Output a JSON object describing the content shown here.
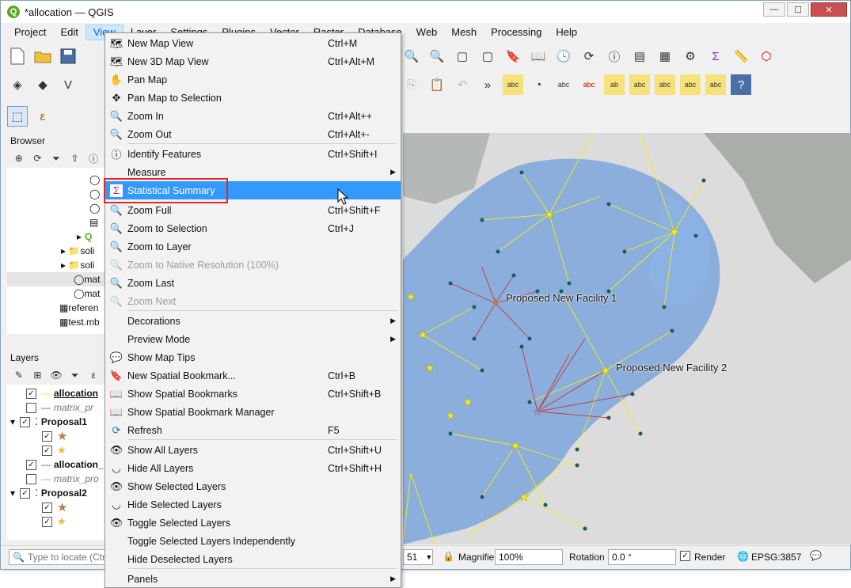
{
  "window": {
    "title": "*allocation — QGIS",
    "app_icon": "Q",
    "controls": {
      "minimize": "—",
      "maximize": "☐",
      "close": "✕"
    }
  },
  "menubar": {
    "items": [
      "Project",
      "Edit",
      "View",
      "Layer",
      "Settings",
      "Plugins",
      "Vector",
      "Raster",
      "Database",
      "Web",
      "Mesh",
      "Processing",
      "Help"
    ],
    "active": "View"
  },
  "browser": {
    "title": "Browser",
    "items": [
      "soli",
      "soli",
      "mat",
      "mat",
      "referen",
      "test.mb"
    ]
  },
  "layers": {
    "title": "Layers",
    "items": [
      "allocation",
      "matrix_pr",
      "Proposal1",
      "★",
      "★",
      "allocation_",
      "matrix_pro",
      "Proposal2",
      "★",
      "★"
    ]
  },
  "view_menu": {
    "items": [
      {
        "label": "New Map View",
        "shortcut": "Ctrl+M",
        "icon": "map-icon"
      },
      {
        "label": "New 3D Map View",
        "shortcut": "Ctrl+Alt+M",
        "icon": "3d-map-icon"
      },
      {
        "label": "Pan Map",
        "shortcut": "",
        "icon": "hand-icon"
      },
      {
        "label": "Pan Map to Selection",
        "shortcut": "",
        "icon": "pan-selection-icon"
      },
      {
        "label": "Zoom In",
        "shortcut": "Ctrl+Alt++",
        "icon": "zoom-in-icon"
      },
      {
        "label": "Zoom Out",
        "shortcut": "Ctrl+Alt+-",
        "icon": "zoom-out-icon"
      },
      {
        "label": "Identify Features",
        "shortcut": "Ctrl+Shift+I",
        "icon": "identify-icon"
      },
      {
        "label": "Measure",
        "shortcut": "",
        "icon": "",
        "submenu": true
      },
      {
        "label": "Statistical Summary",
        "shortcut": "",
        "icon": "sigma-icon",
        "highlight": true
      },
      {
        "label": "Zoom Full",
        "shortcut": "Ctrl+Shift+F",
        "icon": "zoom-full-icon"
      },
      {
        "label": "Zoom to Selection",
        "shortcut": "Ctrl+J",
        "icon": "zoom-selection-icon"
      },
      {
        "label": "Zoom to Layer",
        "shortcut": "",
        "icon": "zoom-layer-icon"
      },
      {
        "label": "Zoom to Native Resolution (100%)",
        "shortcut": "",
        "icon": "zoom-native-icon",
        "disabled": true
      },
      {
        "label": "Zoom Last",
        "shortcut": "",
        "icon": "zoom-last-icon"
      },
      {
        "label": "Zoom Next",
        "shortcut": "",
        "icon": "zoom-next-icon",
        "disabled": true
      },
      {
        "label": "Decorations",
        "shortcut": "",
        "icon": "",
        "submenu": true
      },
      {
        "label": "Preview Mode",
        "shortcut": "",
        "icon": "",
        "submenu": true
      },
      {
        "label": "Show Map Tips",
        "shortcut": "",
        "icon": "map-tips-icon"
      },
      {
        "label": "New Spatial Bookmark...",
        "shortcut": "Ctrl+B",
        "icon": "bookmark-new-icon"
      },
      {
        "label": "Show Spatial Bookmarks",
        "shortcut": "Ctrl+Shift+B",
        "icon": "bookmarks-icon"
      },
      {
        "label": "Show Spatial Bookmark Manager",
        "shortcut": "",
        "icon": "bookmark-manager-icon"
      },
      {
        "label": "Refresh",
        "shortcut": "F5",
        "icon": "refresh-icon"
      },
      {
        "label": "Show All Layers",
        "shortcut": "Ctrl+Shift+U",
        "icon": "show-layers-icon"
      },
      {
        "label": "Hide All Layers",
        "shortcut": "Ctrl+Shift+H",
        "icon": "hide-layers-icon"
      },
      {
        "label": "Show Selected Layers",
        "shortcut": "",
        "icon": "show-selected-icon"
      },
      {
        "label": "Hide Selected Layers",
        "shortcut": "",
        "icon": "hide-selected-icon"
      },
      {
        "label": "Toggle Selected Layers",
        "shortcut": "",
        "icon": "toggle-icon"
      },
      {
        "label": "Toggle Selected Layers Independently",
        "shortcut": "",
        "icon": ""
      },
      {
        "label": "Hide Deselected Layers",
        "shortcut": "",
        "icon": ""
      },
      {
        "label": "Panels",
        "shortcut": "",
        "icon": "",
        "submenu": true
      }
    ]
  },
  "map": {
    "labels": [
      "Proposed New Facility 1",
      "Proposed New Facility 2"
    ],
    "colors": {
      "base": "#dcdcdc",
      "roads": "#7ea6dc",
      "yellow_lines": "#f2f20a",
      "red_lines": "#c0393b",
      "water": "#7d8b86"
    }
  },
  "statusbar": {
    "locator_placeholder": "Type to locate (Ctrl+K)",
    "scale_tail": "51",
    "magnifier_label": "Magnifier",
    "magnifier_value": "100%",
    "rotation_label": "Rotation",
    "rotation_value": "0.0 °",
    "render_label": "Render",
    "crs": "EPSG:3857"
  }
}
